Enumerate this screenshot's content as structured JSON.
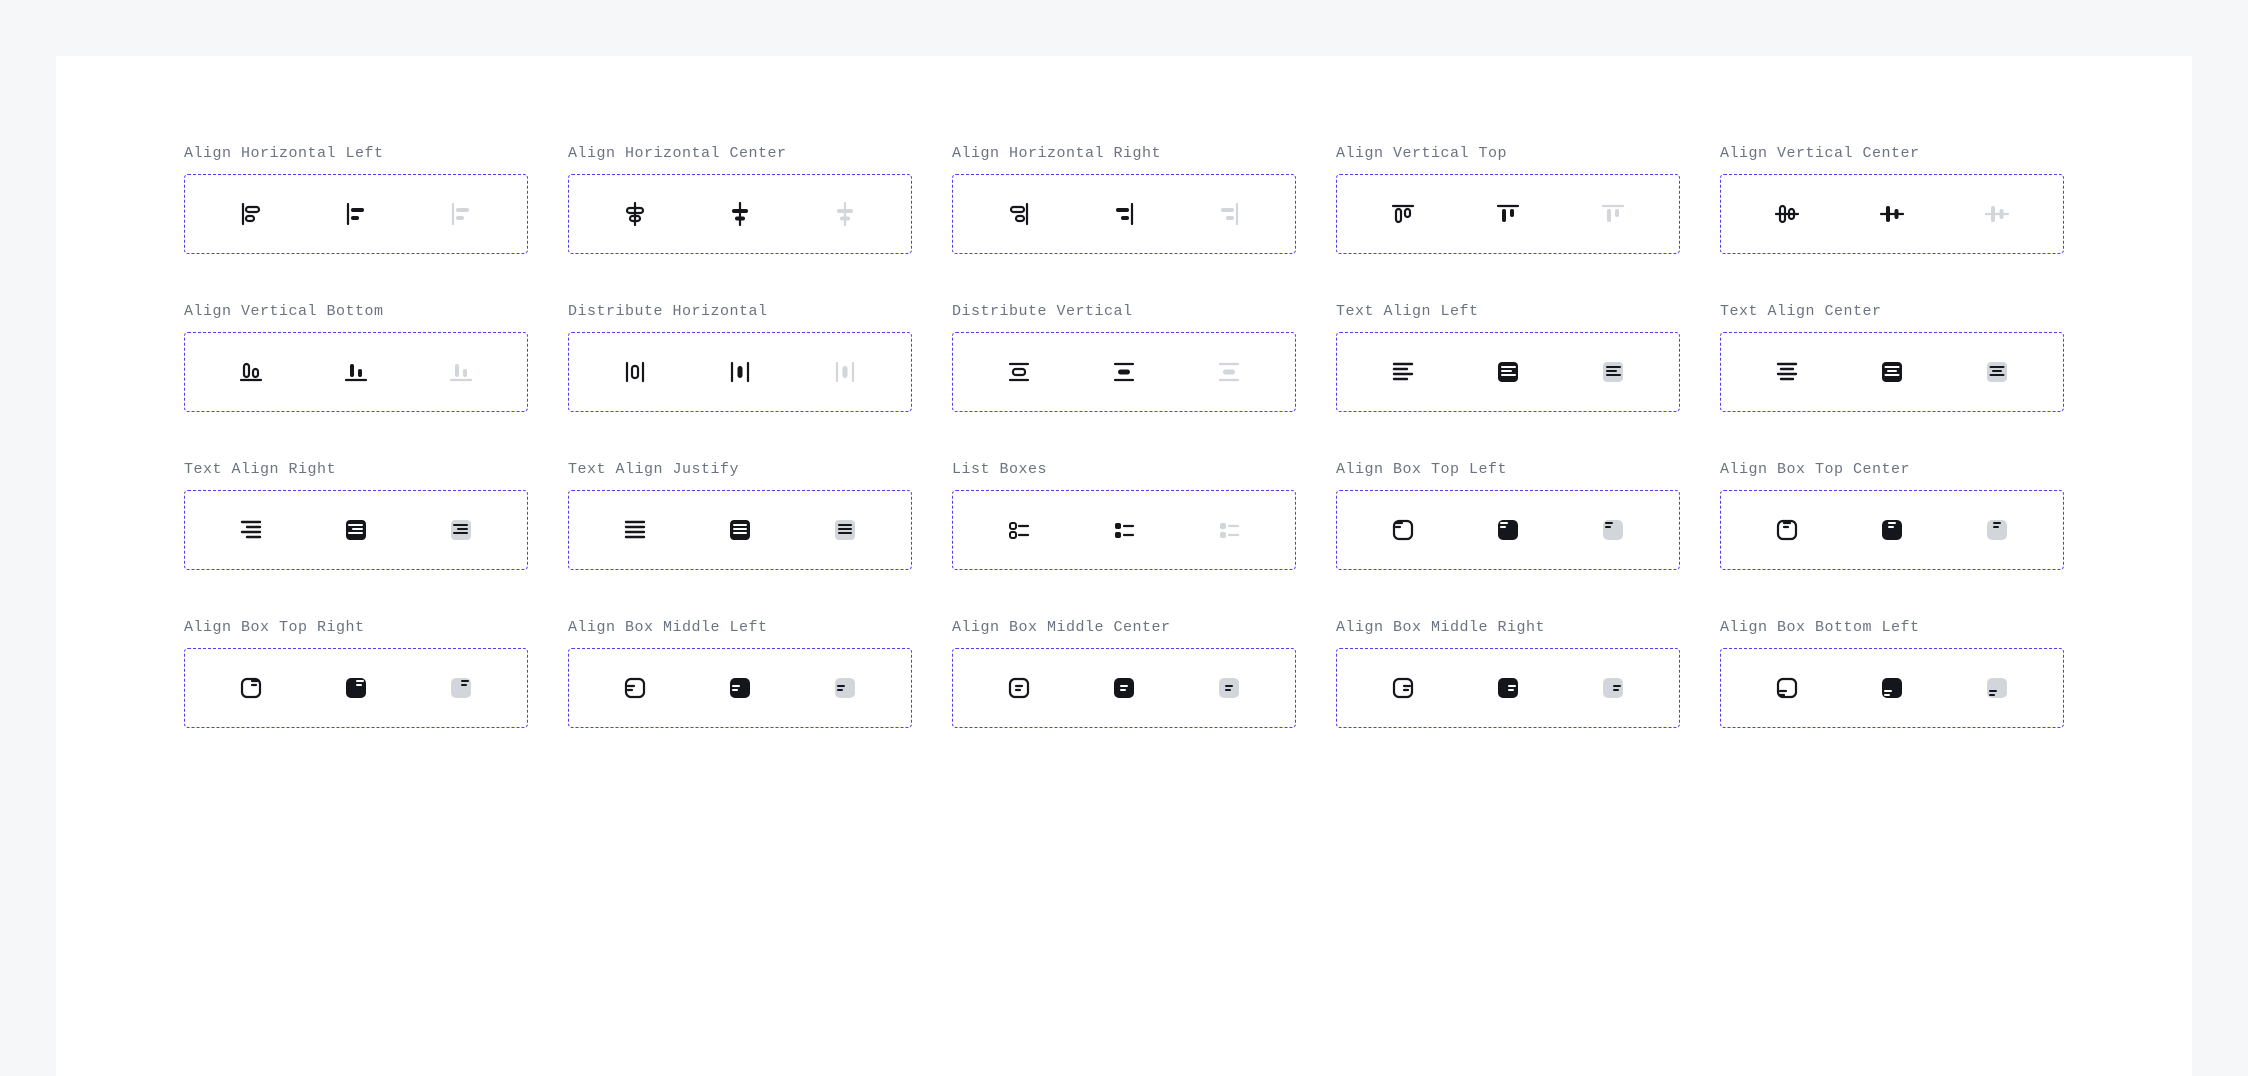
{
  "items": [
    {
      "label": "Align Horizontal Left",
      "key": "align-horizontal-left"
    },
    {
      "label": "Align Horizontal Center",
      "key": "align-horizontal-center"
    },
    {
      "label": "Align Horizontal Right",
      "key": "align-horizontal-right"
    },
    {
      "label": "Align Vertical Top",
      "key": "align-vertical-top"
    },
    {
      "label": "Align Vertical Center",
      "key": "align-vertical-center"
    },
    {
      "label": "Align Vertical Bottom",
      "key": "align-vertical-bottom"
    },
    {
      "label": "Distribute Horizontal",
      "key": "distribute-horizontal"
    },
    {
      "label": "Distribute Vertical",
      "key": "distribute-vertical"
    },
    {
      "label": "Text Align Left",
      "key": "text-align-left"
    },
    {
      "label": "Text Align Center",
      "key": "text-align-center"
    },
    {
      "label": "Text Align Right",
      "key": "text-align-right"
    },
    {
      "label": "Text Align Justify",
      "key": "text-align-justify"
    },
    {
      "label": "List Boxes",
      "key": "list-boxes"
    },
    {
      "label": "Align Box Top Left",
      "key": "align-box-top-left"
    },
    {
      "label": "Align Box Top Center",
      "key": "align-box-top-center"
    },
    {
      "label": "Align Box Top Right",
      "key": "align-box-top-right"
    },
    {
      "label": "Align Box Middle Left",
      "key": "align-box-middle-left"
    },
    {
      "label": "Align Box Middle Center",
      "key": "align-box-middle-center"
    },
    {
      "label": "Align Box Middle Right",
      "key": "align-box-middle-right"
    },
    {
      "label": "Align Box Bottom Left",
      "key": "align-box-bottom-left"
    }
  ],
  "variants": [
    "outline",
    "filled",
    "muted"
  ],
  "colors": {
    "dark": "#14161b",
    "muted": "#d2d5da",
    "border_dash": "#4f3df0",
    "label": "#6c7380"
  }
}
